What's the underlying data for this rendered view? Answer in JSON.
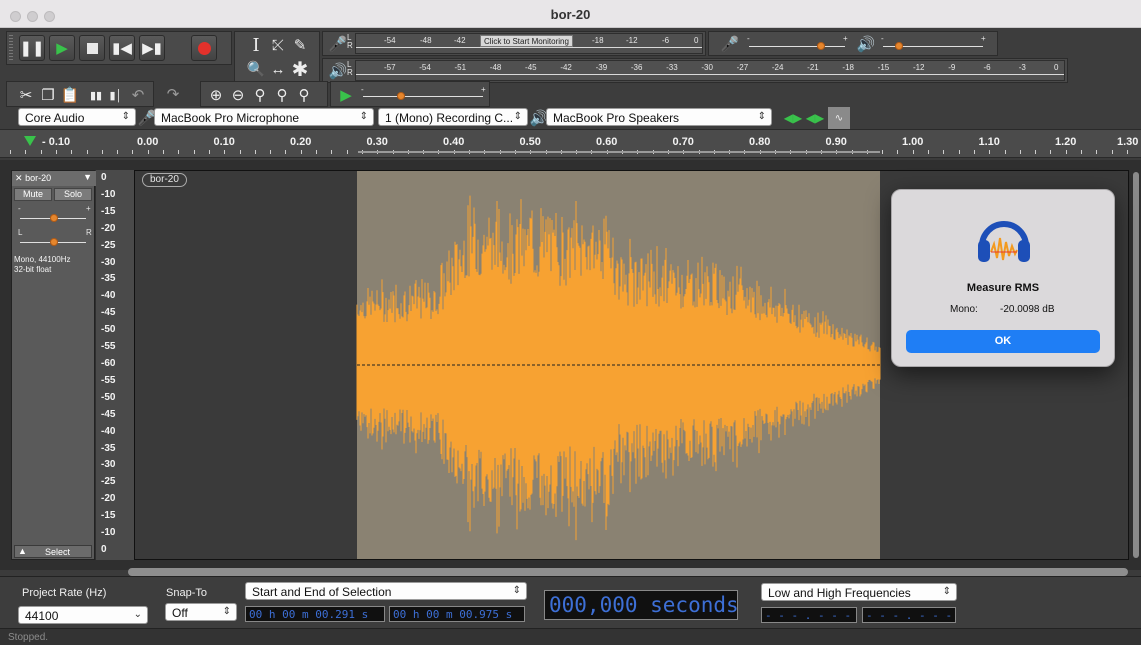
{
  "window": {
    "title": "bor-20"
  },
  "meters": {
    "record_scale": [
      "-54",
      "-48",
      "-42",
      "-18",
      "-12",
      "-6",
      "0"
    ],
    "monitor_label": "Click to Start Monitoring",
    "play_scale": [
      "-57",
      "-54",
      "-51",
      "-48",
      "-45",
      "-42",
      "-39",
      "-36",
      "-33",
      "-30",
      "-27",
      "-24",
      "-21",
      "-18",
      "-15",
      "-12",
      "-9",
      "-6",
      "-3",
      "0"
    ],
    "lr_left": "L",
    "lr_right": "R",
    "slider_minus": "-",
    "slider_plus": "+"
  },
  "device": {
    "host": "Core Audio",
    "input": "MacBook Pro Microphone",
    "channels": "1 (Mono) Recording C...",
    "output": "MacBook Pro Speakers"
  },
  "ruler": {
    "ticks": [
      "- 0.10",
      "0.00",
      "0.10",
      "0.20",
      "0.30",
      "0.40",
      "0.50",
      "0.60",
      "0.70",
      "0.80",
      "0.90",
      "1.00",
      "1.10",
      "1.20",
      "1.30"
    ]
  },
  "track": {
    "name": "bor-20",
    "clip_name": "bor-20",
    "mute": "Mute",
    "solo": "Solo",
    "gain_minus": "-",
    "gain_plus": "+",
    "pan_left": "L",
    "pan_right": "R",
    "info_line1": "Mono, 44100Hz",
    "info_line2": "32-bit float",
    "select_label": "Select",
    "db_scale": [
      "0",
      "-10",
      "-15",
      "-20",
      "-25",
      "-30",
      "-35",
      "-40",
      "-45",
      "-50",
      "-55",
      "-60",
      "-55",
      "-50",
      "-45",
      "-40",
      "-35",
      "-30",
      "-25",
      "-20",
      "-15",
      "-10",
      "0"
    ],
    "waveform_color": "#f7a232",
    "selection_color": "#8a8272"
  },
  "selection_toolbar": {
    "project_rate_label": "Project Rate (Hz)",
    "project_rate_value": "44100",
    "snap_label": "Snap-To",
    "snap_value": "Off",
    "selection_mode": "Start and End of Selection",
    "start_time": "00 h 00 m 00.291 s",
    "end_time": "00 h 00 m 00.975 s",
    "audio_position": "000,000 seconds",
    "spectral_mode": "Low and High Frequencies",
    "low_freq": "- - - . - - -  kHz",
    "high_freq": "- - - . - - -  kHz"
  },
  "status": "Stopped.",
  "dialog": {
    "title": "Measure RMS",
    "row_label": "Mono:",
    "row_value": "-20.0098 dB",
    "ok_label": "OK"
  }
}
